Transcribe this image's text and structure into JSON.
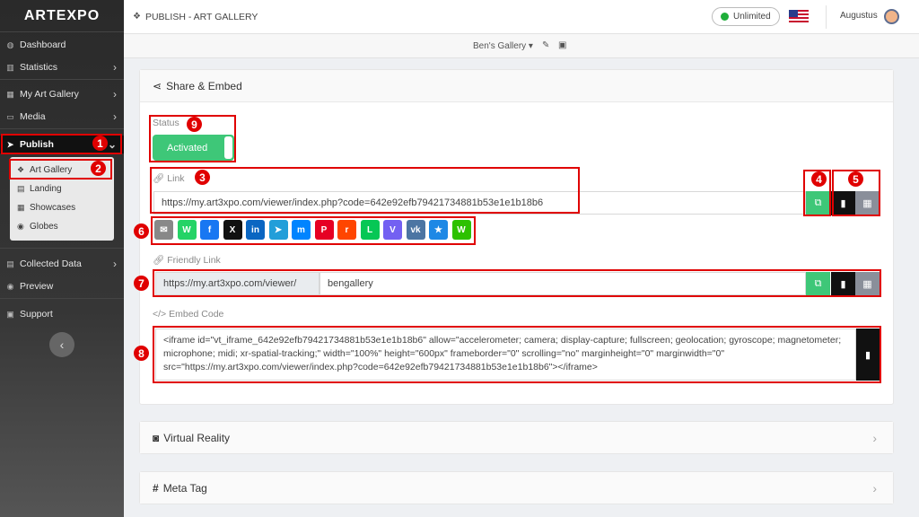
{
  "app": {
    "logo": "ARTEXPO"
  },
  "sidebar": {
    "items": [
      {
        "label": "Dashboard",
        "icon": "dashboard-icon"
      },
      {
        "label": "Statistics",
        "icon": "chart-icon"
      },
      {
        "label": "My Art Gallery",
        "icon": "gallery-icon"
      },
      {
        "label": "Media",
        "icon": "monitor-icon"
      },
      {
        "label": "Publish",
        "icon": "send-icon"
      },
      {
        "label": "Collected Data",
        "icon": "database-icon"
      },
      {
        "label": "Preview",
        "icon": "eye-icon"
      },
      {
        "label": "Support",
        "icon": "support-icon"
      }
    ],
    "submenu": [
      {
        "label": "Art Gallery",
        "icon": "gallery-icon"
      },
      {
        "label": "Landing",
        "icon": "file-icon"
      },
      {
        "label": "Showcases",
        "icon": "grid-icon"
      },
      {
        "label": "Globes",
        "icon": "globe-icon"
      }
    ]
  },
  "header": {
    "title": "PUBLISH - ART GALLERY",
    "plan": "Unlimited",
    "user": "Augustus"
  },
  "subbar": {
    "gallery": "Ben's Gallery"
  },
  "share": {
    "title": "Share & Embed",
    "status_label": "Status",
    "status_value": "Activated",
    "link_label": "Link",
    "link_value": "https://my.art3xpo.com/viewer/index.php?code=642e92efb79421734881b53e1e1b18b6",
    "friendly_label": "Friendly Link",
    "friendly_prefix": "https://my.art3xpo.com/viewer/",
    "friendly_value": "bengallery",
    "embed_label": "Embed Code",
    "embed_value": "<iframe id=\"vt_iframe_642e92efb79421734881b53e1e1b18b6\" allow=\"accelerometer; camera; display-capture; fullscreen; geolocation; gyroscope; magnetometer; microphone; midi; xr-spatial-tracking;\" width=\"100%\" height=\"600px\" frameborder=\"0\" scrolling=\"no\" marginheight=\"0\" marginwidth=\"0\" src=\"https://my.art3xpo.com/viewer/index.php?code=642e92efb79421734881b53e1e1b18b6\"></iframe>"
  },
  "sections": {
    "vr": "Virtual Reality",
    "meta": "Meta Tag"
  },
  "callouts": [
    "1",
    "2",
    "3",
    "4",
    "5",
    "6",
    "7",
    "8",
    "9"
  ],
  "socials": [
    {
      "name": "email",
      "color": "#888888",
      "glyph": "✉"
    },
    {
      "name": "whatsapp",
      "color": "#25d366",
      "glyph": "W"
    },
    {
      "name": "facebook",
      "color": "#1877f2",
      "glyph": "f"
    },
    {
      "name": "x",
      "color": "#111111",
      "glyph": "X"
    },
    {
      "name": "linkedin",
      "color": "#0a66c2",
      "glyph": "in"
    },
    {
      "name": "telegram",
      "color": "#229ed9",
      "glyph": "➤"
    },
    {
      "name": "messenger",
      "color": "#0084ff",
      "glyph": "m"
    },
    {
      "name": "pinterest",
      "color": "#e60023",
      "glyph": "P"
    },
    {
      "name": "reddit",
      "color": "#ff4500",
      "glyph": "r"
    },
    {
      "name": "line",
      "color": "#06c755",
      "glyph": "L"
    },
    {
      "name": "viber",
      "color": "#7360f2",
      "glyph": "V"
    },
    {
      "name": "vk",
      "color": "#4c75a3",
      "glyph": "vk"
    },
    {
      "name": "star",
      "color": "#1e88e5",
      "glyph": "★"
    },
    {
      "name": "wechat",
      "color": "#2dc100",
      "glyph": "W"
    }
  ]
}
